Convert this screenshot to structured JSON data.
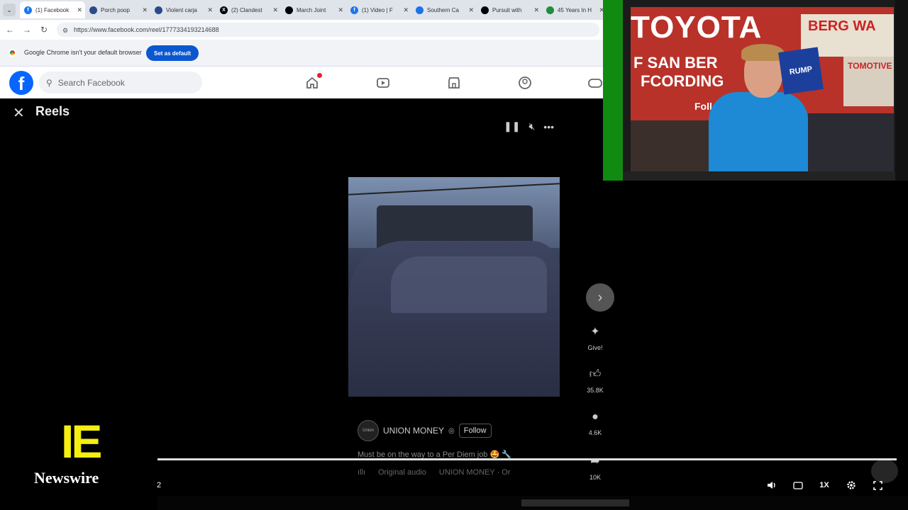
{
  "browser": {
    "tabs": [
      {
        "label": "(1) Facebook",
        "icon": "facebook-icon",
        "color": "#1877f2",
        "active": true
      },
      {
        "label": "Porch poop",
        "icon": "news-icon",
        "color": "#2b4a8b"
      },
      {
        "label": "Violent carja",
        "icon": "news-icon",
        "color": "#2b4a8b"
      },
      {
        "label": "(2) Clandest",
        "icon": "x-icon",
        "color": "#000000"
      },
      {
        "label": "March Joint",
        "icon": "news-icon",
        "color": "#000000"
      },
      {
        "label": "(1) Video | F",
        "icon": "facebook-icon",
        "color": "#1877f2"
      },
      {
        "label": "Southern Ca",
        "icon": "news-icon",
        "color": "#1a73e8"
      },
      {
        "label": "Pursuit with",
        "icon": "news-icon",
        "color": "#000000"
      },
      {
        "label": "45 Years In H",
        "icon": "news-icon",
        "color": "#1e8e3e"
      }
    ],
    "url": "https://www.facebook.com/reel/1777334193214688",
    "infobar": {
      "text": "Google Chrome isn't your default browser",
      "button": "Set as default"
    }
  },
  "facebook": {
    "search_placeholder": "Search Facebook",
    "brand_color": "#0866ff",
    "reels_title": "Reels"
  },
  "reel": {
    "author": "UNION MONEY",
    "avatar_text": "Union",
    "follow_label": "Follow",
    "caption": "Must be on the way to a Per Diem job 🤩 🔧",
    "audio_label": "Original audio",
    "audio_credit": "UNION MONEY · Or",
    "actions": [
      {
        "icon": "give-icon",
        "label": "Give!"
      },
      {
        "icon": "like-icon",
        "label": "35.8K"
      },
      {
        "icon": "comment-icon",
        "label": "4.6K"
      },
      {
        "icon": "share-icon",
        "label": "10K"
      }
    ]
  },
  "stream": {
    "banner_main": "TOYOTA",
    "banner_line2": "F SAN BER",
    "banner_line3": "FCORDING",
    "banner_line4": "Follo",
    "banner_right": "BERG WA",
    "banner_right2": "TOMOTIVE",
    "sign_text": "RUMP"
  },
  "overlay": {
    "logo_text": "IE",
    "logo_sub": "Newswire",
    "logo_color": "#f5ee10"
  },
  "player": {
    "timecode": "2",
    "speed": "1X"
  }
}
